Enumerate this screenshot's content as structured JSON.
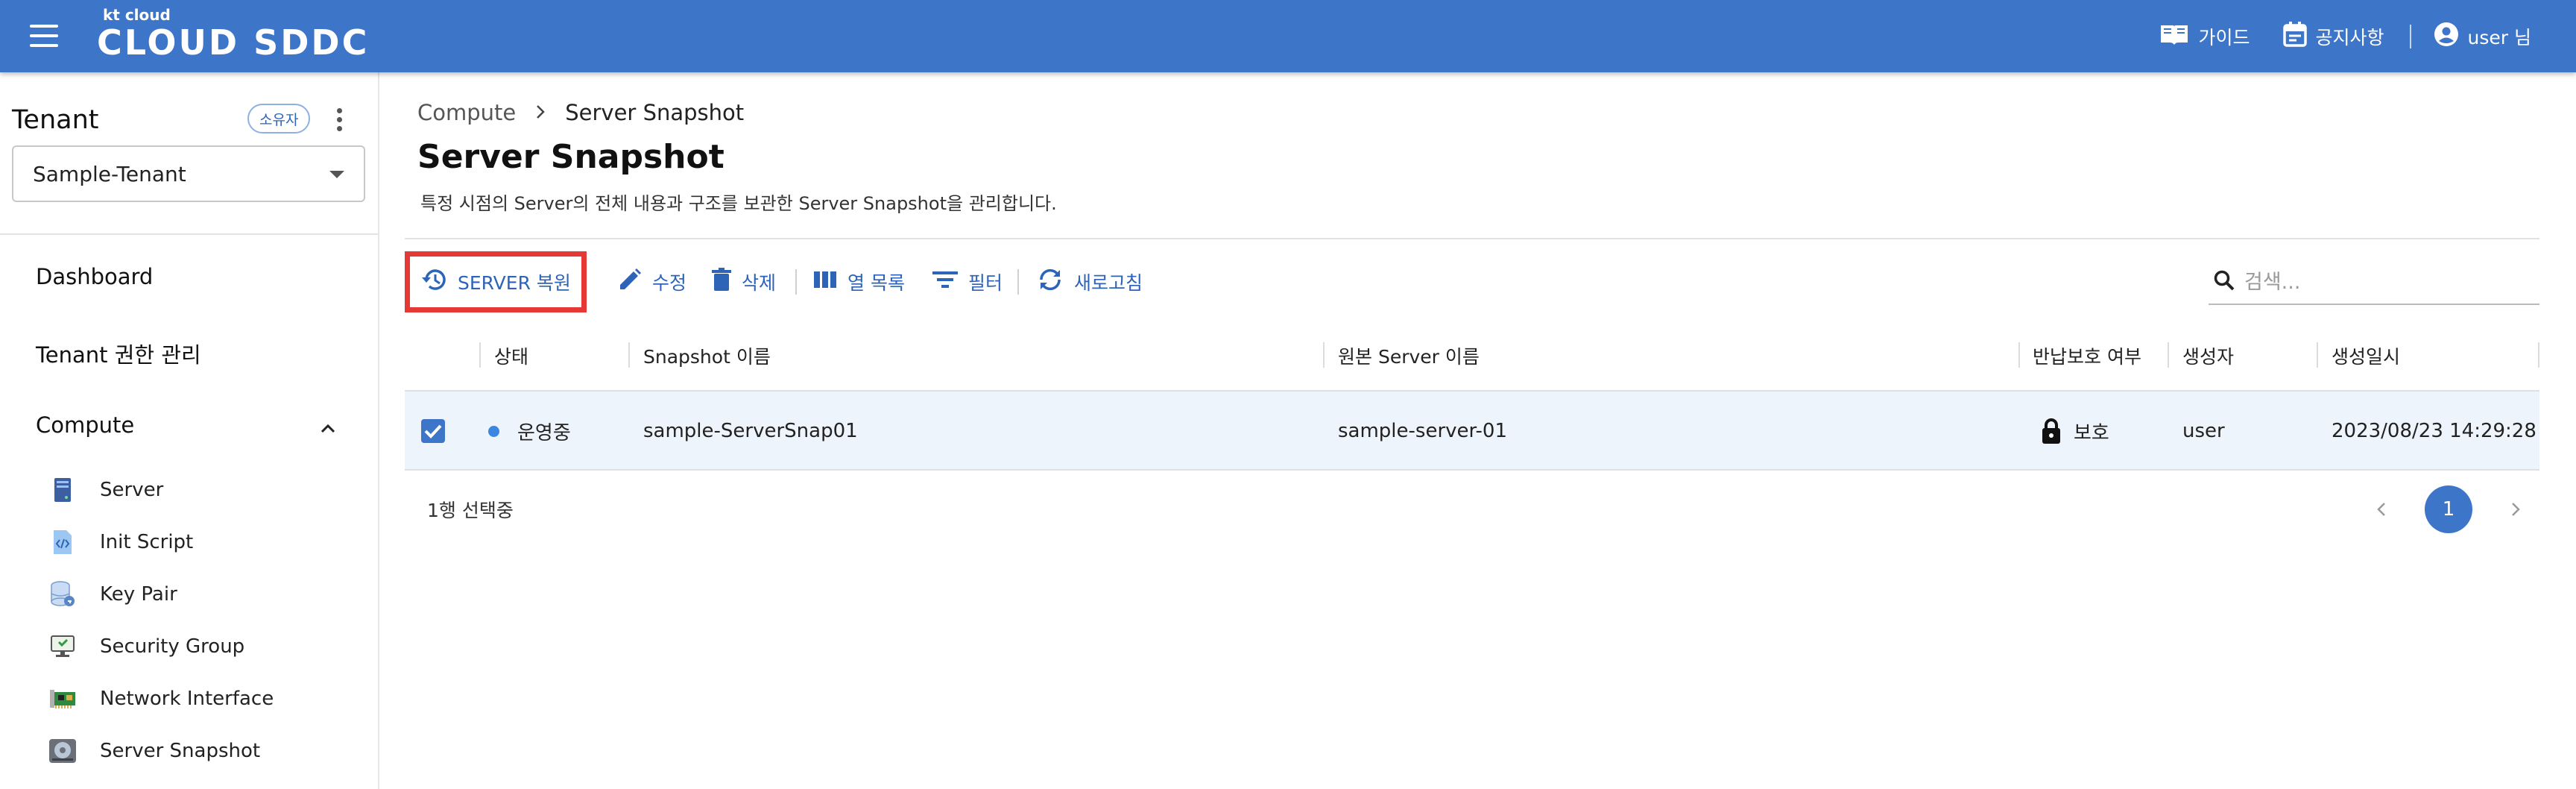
{
  "topbar": {
    "logo_small": "kt cloud",
    "logo_big": "CLOUD SDDC",
    "guide_label": "가이드",
    "notice_label": "공지사항",
    "user_label": "user 님"
  },
  "sidebar": {
    "tenant_title": "Tenant",
    "owner_badge": "소유자",
    "tenant_selected": "Sample-Tenant",
    "nav": {
      "dashboard": "Dashboard",
      "tenant_auth": "Tenant 권한 관리",
      "compute": "Compute"
    },
    "compute_items": [
      {
        "label": "Server",
        "icon": "server-icon"
      },
      {
        "label": "Init Script",
        "icon": "init-script-icon"
      },
      {
        "label": "Key Pair",
        "icon": "key-pair-icon"
      },
      {
        "label": "Security Group",
        "icon": "security-group-icon"
      },
      {
        "label": "Network Interface",
        "icon": "network-interface-icon"
      },
      {
        "label": "Server Snapshot",
        "icon": "server-snapshot-icon"
      }
    ]
  },
  "main": {
    "breadcrumb": {
      "parent": "Compute",
      "current": "Server Snapshot"
    },
    "title": "Server Snapshot",
    "description": "특정 시점의 Server의 전체 내용과 구조를 보관한 Server Snapshot을 관리합니다.",
    "toolbar": {
      "restore": "SERVER 복원",
      "edit": "수정",
      "delete": "삭제",
      "columns": "열 목록",
      "filter": "필터",
      "refresh": "새로고침",
      "search_placeholder": "검색..."
    },
    "table": {
      "headers": [
        "상태",
        "Snapshot 이름",
        "원본 Server 이름",
        "반납보호 여부",
        "생성자",
        "생성일시"
      ],
      "rows": [
        {
          "status": "운영중",
          "snapshot_name": "sample-ServerSnap01",
          "source_server": "sample-server-01",
          "protection": "보호",
          "creator": "user",
          "created_at": "2023/08/23 14:29:28"
        }
      ],
      "selection_text": "1행 선택중",
      "current_page": "1"
    }
  },
  "colors": {
    "primary": "#3d75c9",
    "accent_text": "#2d64b8",
    "highlight_border": "#e53935",
    "selected_row": "#eef4fb",
    "status_running": "#3d86e0"
  }
}
